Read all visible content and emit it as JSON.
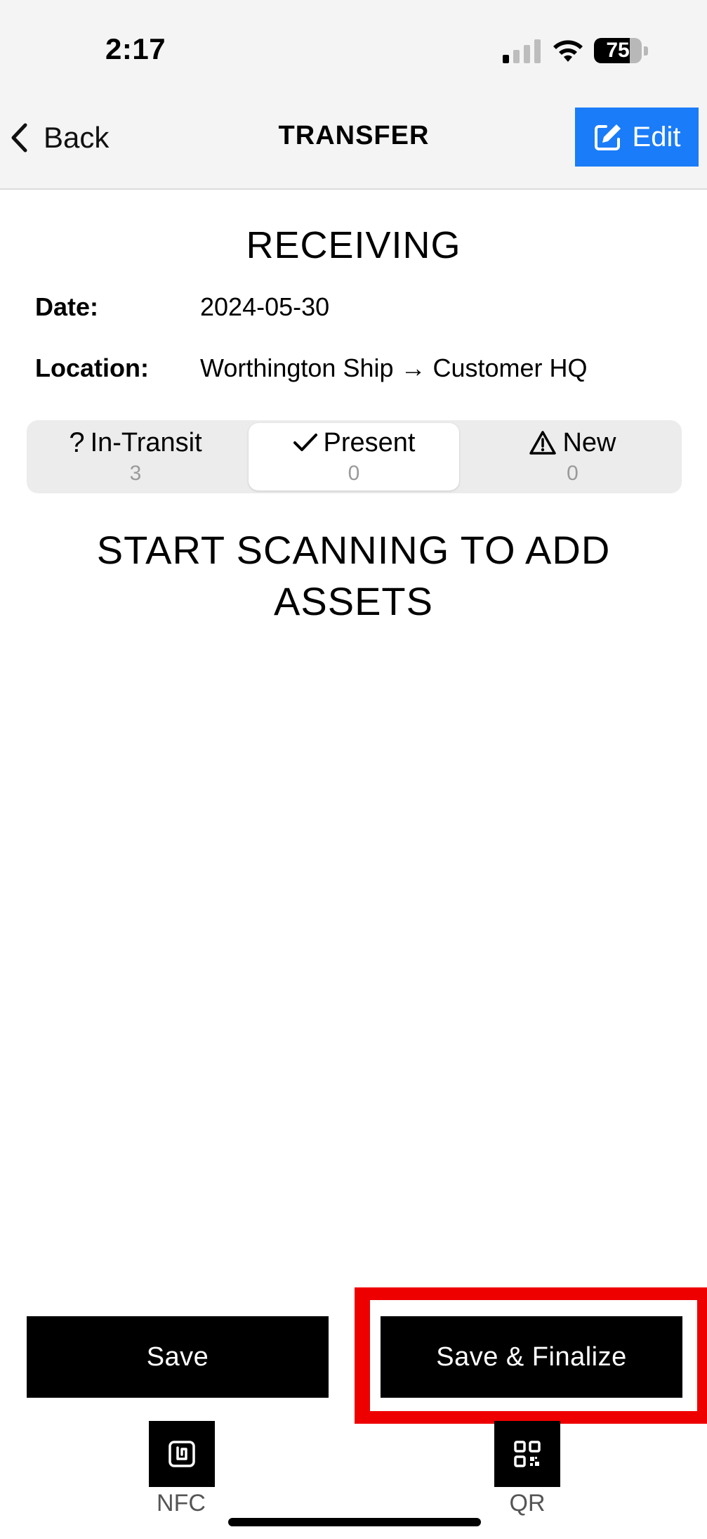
{
  "status_bar": {
    "time": "2:17",
    "battery_level": "75",
    "battery_fraction": 0.75
  },
  "nav": {
    "back_label": "Back",
    "title": "TRANSFER",
    "edit_label": "Edit",
    "edit_color": "#1a7cf8"
  },
  "main": {
    "heading": "RECEIVING",
    "date_label": "Date:",
    "date_value": "2024-05-30",
    "location_label": "Location:",
    "location_value": "Worthington Ship → Customer HQ"
  },
  "segments": [
    {
      "icon": "question-icon",
      "label": "In-Transit",
      "count": "3",
      "active": false
    },
    {
      "icon": "check-icon",
      "label": "Present",
      "count": "0",
      "active": true
    },
    {
      "icon": "warning-icon",
      "label": "New",
      "count": "0",
      "active": false
    }
  ],
  "empty_state": {
    "message": "START SCANNING TO ADD ASSETS"
  },
  "actions": {
    "save_label": "Save",
    "save_finalize_label": "Save & Finalize",
    "highlight_color": "#ee0000"
  },
  "scanners": {
    "nfc_label": "NFC",
    "nfc_icon": "nfc-icon",
    "qr_label": "QR",
    "qr_icon": "qr-code-icon"
  }
}
